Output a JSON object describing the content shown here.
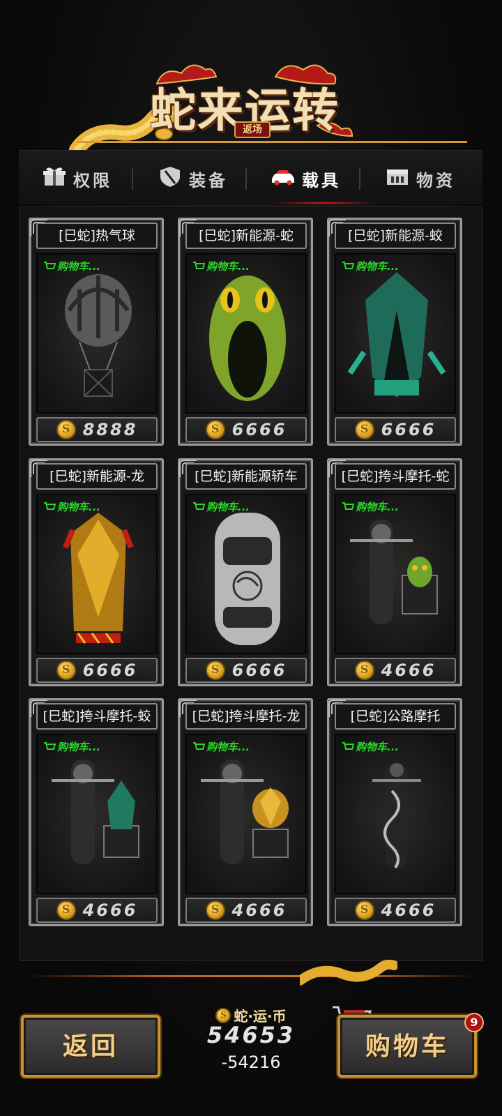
{
  "header": {
    "title": "蛇来运转",
    "subtitle": "返场"
  },
  "tabs": [
    {
      "label": "权限",
      "icon": "gift-box-icon",
      "active": false
    },
    {
      "label": "装备",
      "icon": "shield-icon",
      "active": false
    },
    {
      "label": "载具",
      "icon": "car-icon",
      "active": true
    },
    {
      "label": "物资",
      "icon": "crate-icon",
      "active": false
    }
  ],
  "cart_tag_label": "购物车...",
  "items": [
    {
      "name": "[巳蛇]热气球",
      "price": "8888",
      "art": "hot-air-balloon"
    },
    {
      "name": "[巳蛇]新能源-蛇",
      "price": "6666",
      "art": "snake-car"
    },
    {
      "name": "[巳蛇]新能源-蛟",
      "price": "6666",
      "art": "jiao-car"
    },
    {
      "name": "[巳蛇]新能源-龙",
      "price": "6666",
      "art": "dragon-car"
    },
    {
      "name": "[巳蛇]新能源轿车",
      "price": "6666",
      "art": "sedan"
    },
    {
      "name": "[巳蛇]挎斗摩托-蛇",
      "price": "4666",
      "art": "sidecar-snake"
    },
    {
      "name": "[巳蛇]挎斗摩托-蛟",
      "price": "4666",
      "art": "sidecar-jiao"
    },
    {
      "name": "[巳蛇]挎斗摩托-龙",
      "price": "4666",
      "art": "sidecar-dragon"
    },
    {
      "name": "[巳蛇]公路摩托",
      "price": "4666",
      "art": "road-bike"
    }
  ],
  "footer": {
    "back_label": "返回",
    "currency_label": "蛇·运·币",
    "currency_amount": "54653",
    "currency_change": "-54216",
    "cart_label": "购物车",
    "cart_count": "9"
  },
  "colors": {
    "accent_gold": "#d79a32",
    "cart_green": "#2bd62b",
    "active_tab_glow": "#e02020",
    "badge_red": "#b01010"
  }
}
